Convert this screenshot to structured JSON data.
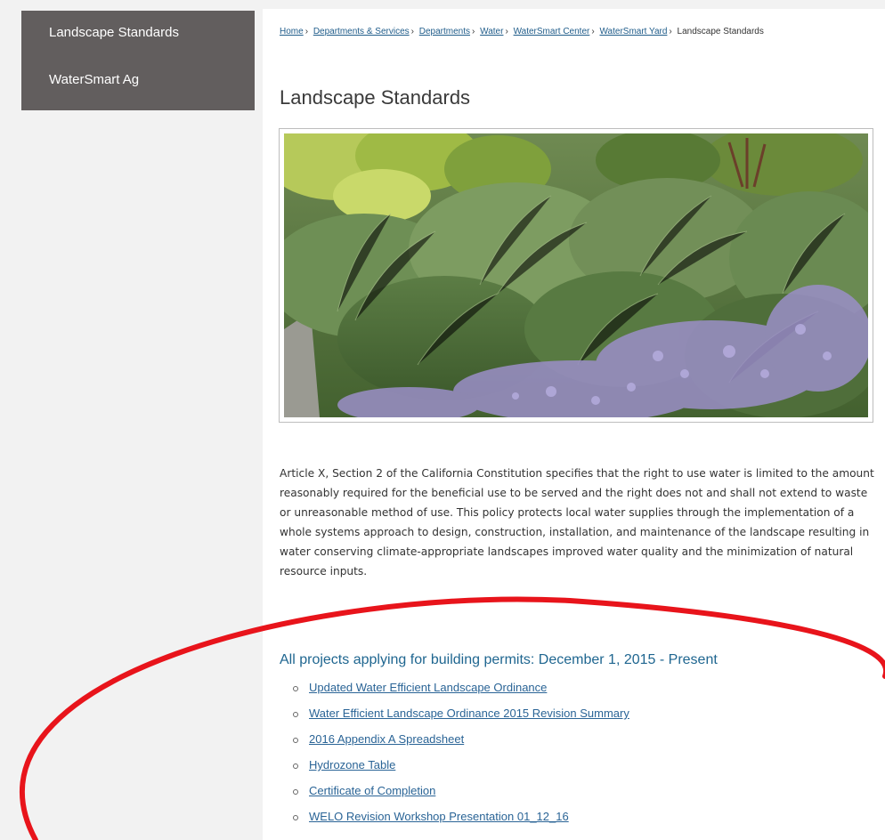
{
  "sidebar": {
    "items": [
      {
        "label": "Landscape Standards"
      },
      {
        "label": "WaterSmart Ag"
      }
    ]
  },
  "breadcrumb": {
    "items": [
      {
        "label": "Home"
      },
      {
        "label": "Departments & Services"
      },
      {
        "label": "Departments"
      },
      {
        "label": "Water"
      },
      {
        "label": "WaterSmart Center"
      },
      {
        "label": "WaterSmart Yard"
      }
    ],
    "separator": "›",
    "current": "Landscape Standards"
  },
  "page": {
    "title": "Landscape Standards",
    "intro": "Article X, Section 2 of the California Constitution specifies that the right to use water is limited to the amount reasonably required for the beneficial use to be served and the right does not and shall not extend to waste or unreasonable method of use. This policy protects local water supplies through the implementation of a whole systems approach to design, construction, installation, and maintenance of the landscape resulting in water conserving climate-appropriate landscapes improved water quality and the minimization of natural resource inputs.",
    "section_heading": "All projects applying for building permits: December 1, 2015 - Present",
    "links": [
      {
        "label": "Updated Water Efficient Landscape Ordinance"
      },
      {
        "label": "Water Efficient Landscape Ordinance 2015 Revision Summary"
      },
      {
        "label": "2016 Appendix A Spreadsheet"
      },
      {
        "label": "Hydrozone Table"
      },
      {
        "label": "Certificate of Completion"
      },
      {
        "label": "WELO Revision  Workshop Presentation 01_12_16"
      }
    ]
  },
  "colors": {
    "sidebar_bg": "#625e5e",
    "link": "#2a6496",
    "heading_accent": "#1f6690",
    "annotation": "#e8141b"
  }
}
